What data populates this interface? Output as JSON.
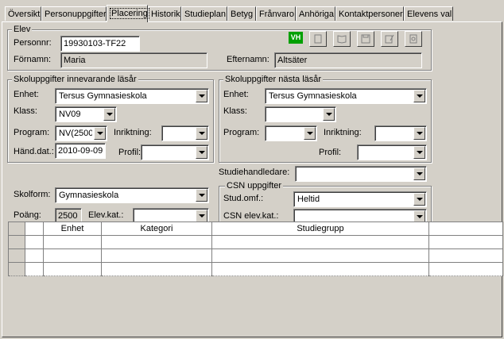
{
  "tabs": [
    {
      "label": "Översikt"
    },
    {
      "label": "Personuppgifter"
    },
    {
      "label": "Placering"
    },
    {
      "label": "Historik"
    },
    {
      "label": "Studieplan"
    },
    {
      "label": "Betyg"
    },
    {
      "label": "Frånvaro"
    },
    {
      "label": "Anhöriga"
    },
    {
      "label": "Kontaktpersoner"
    },
    {
      "label": "Elevens val"
    }
  ],
  "active_tab": "Placering",
  "elev": {
    "legend": "Elev",
    "personnr_label": "Personnr:",
    "personnr_value": "19930103-TF22",
    "fornamn_label": "Förnamn:",
    "fornamn_value": "Maria",
    "efternamn_label": "Efternamn:",
    "efternamn_value": "Altsäter",
    "badge": "VH"
  },
  "current_year": {
    "legend": "Skoluppgifter innevarande läsår",
    "enhet_label": "Enhet:",
    "enhet_value": "Tersus Gymnasieskola",
    "klass_label": "Klass:",
    "klass_value": "NV09",
    "program_label": "Program:",
    "program_value": "NV(2500",
    "inriktning_label": "Inriktning:",
    "inriktning_value": "",
    "hand_label": "Händ.dat.:",
    "hand_value": "2010-09-09",
    "profil_label": "Profil:",
    "profil_value": ""
  },
  "next_year": {
    "legend": "Skoluppgifter nästa läsår",
    "enhet_label": "Enhet:",
    "enhet_value": "Tersus Gymnasieskola",
    "klass_label": "Klass:",
    "klass_value": "",
    "program_label": "Program:",
    "program_value": "",
    "inriktning_label": "Inriktning:",
    "inriktning_value": "",
    "profil_label": "Profil:",
    "profil_value": ""
  },
  "studiehandledare_label": "Studiehandledare:",
  "studiehandledare_value": "",
  "skolform_label": "Skolform:",
  "skolform_value": "Gymnasieskola",
  "poang_label": "Poäng:",
  "poang_value": "2500",
  "elevkat_label": "Elev.kat.:",
  "elevkat_value": "",
  "csn": {
    "legend": "CSN uppgifter",
    "studomf_label": "Stud.omf.:",
    "studomf_value": "Heltid",
    "elevkat_label": "CSN elev.kat.:",
    "elevkat_value": ""
  },
  "grid": {
    "columns": [
      "",
      "",
      "Enhet",
      "Kategori",
      "Studiegrupp",
      ""
    ],
    "rows": [
      [
        "",
        "",
        "",
        "",
        "",
        ""
      ],
      [
        "",
        "",
        "",
        "",
        "",
        ""
      ],
      [
        "",
        "",
        "",
        "",
        "",
        ""
      ]
    ]
  }
}
